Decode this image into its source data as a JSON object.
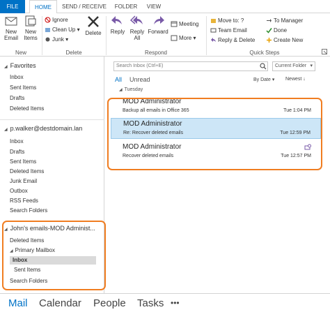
{
  "ribbon_tabs": [
    {
      "label": "FILE"
    },
    {
      "label": "HOME"
    },
    {
      "label": "SEND / RECEIVE"
    },
    {
      "label": "FOLDER"
    },
    {
      "label": "VIEW"
    }
  ],
  "ribbon": {
    "new_group": {
      "label": "New",
      "new_email": "New\nEmail",
      "new_email_l1": "New",
      "new_email_l2": "Email",
      "new_items_l1": "New",
      "new_items_l2": "Items"
    },
    "delete_group": {
      "label": "Delete",
      "ignore": "Ignore",
      "cleanup": "Clean Up",
      "junk": "Junk",
      "delete": "Delete"
    },
    "respond_group": {
      "label": "Respond",
      "reply": "Reply",
      "reply_all_l1": "Reply",
      "reply_all_l2": "All",
      "forward": "Forward",
      "meeting": "Meeting",
      "more": "More"
    },
    "quicksteps_group": {
      "label": "Quick Steps",
      "move_to": "Move to: ?",
      "team_email": "Team Email",
      "reply_delete": "Reply & Delete",
      "to_manager": "To Manager",
      "done": "Done",
      "create_new": "Create New"
    }
  },
  "nav": {
    "favorites_header": "Favorites",
    "favorites": [
      "Inbox",
      "Sent Items",
      "Drafts",
      "Deleted Items"
    ],
    "account_header": "p.walker@destdomain.lan",
    "account_folders": [
      "Inbox",
      "Drafts",
      "Sent Items",
      "Deleted Items",
      "Junk Email",
      "Outbox",
      "RSS Feeds",
      "Search Folders"
    ],
    "shared_header": "John's emails-MOD Administ...",
    "shared_folders": {
      "deleted": "Deleted Items",
      "primary": "Primary Mailbox",
      "inbox": "Inbox",
      "sent": "Sent Items",
      "search": "Search Folders"
    }
  },
  "messages_pane": {
    "search_placeholder": "Search Inbox (Ctrl+E)",
    "folder_scope": "Current Folder",
    "filter_all": "All",
    "filter_unread": "Unread",
    "sort_by": "By Date",
    "sort_order": "Newest",
    "group_header": "Tuesday",
    "messages": [
      {
        "from": "MOD Administrator",
        "subject": "Backup all emails in Office 365",
        "time": "Tue 1:04 PM"
      },
      {
        "from": "MOD Administrator",
        "subject": "Re: Recover deleted emails",
        "time": "Tue 12:59 PM"
      },
      {
        "from": "MOD Administrator",
        "subject": "Recover deleted emails",
        "time": "Tue 12:57 PM"
      }
    ]
  },
  "bottom_nav": {
    "mail": "Mail",
    "calendar": "Calendar",
    "people": "People",
    "tasks": "Tasks",
    "more": "•••"
  },
  "colors": {
    "accent": "#0072c6",
    "highlight": "#f07d21",
    "selected_row": "#cde6f7"
  }
}
